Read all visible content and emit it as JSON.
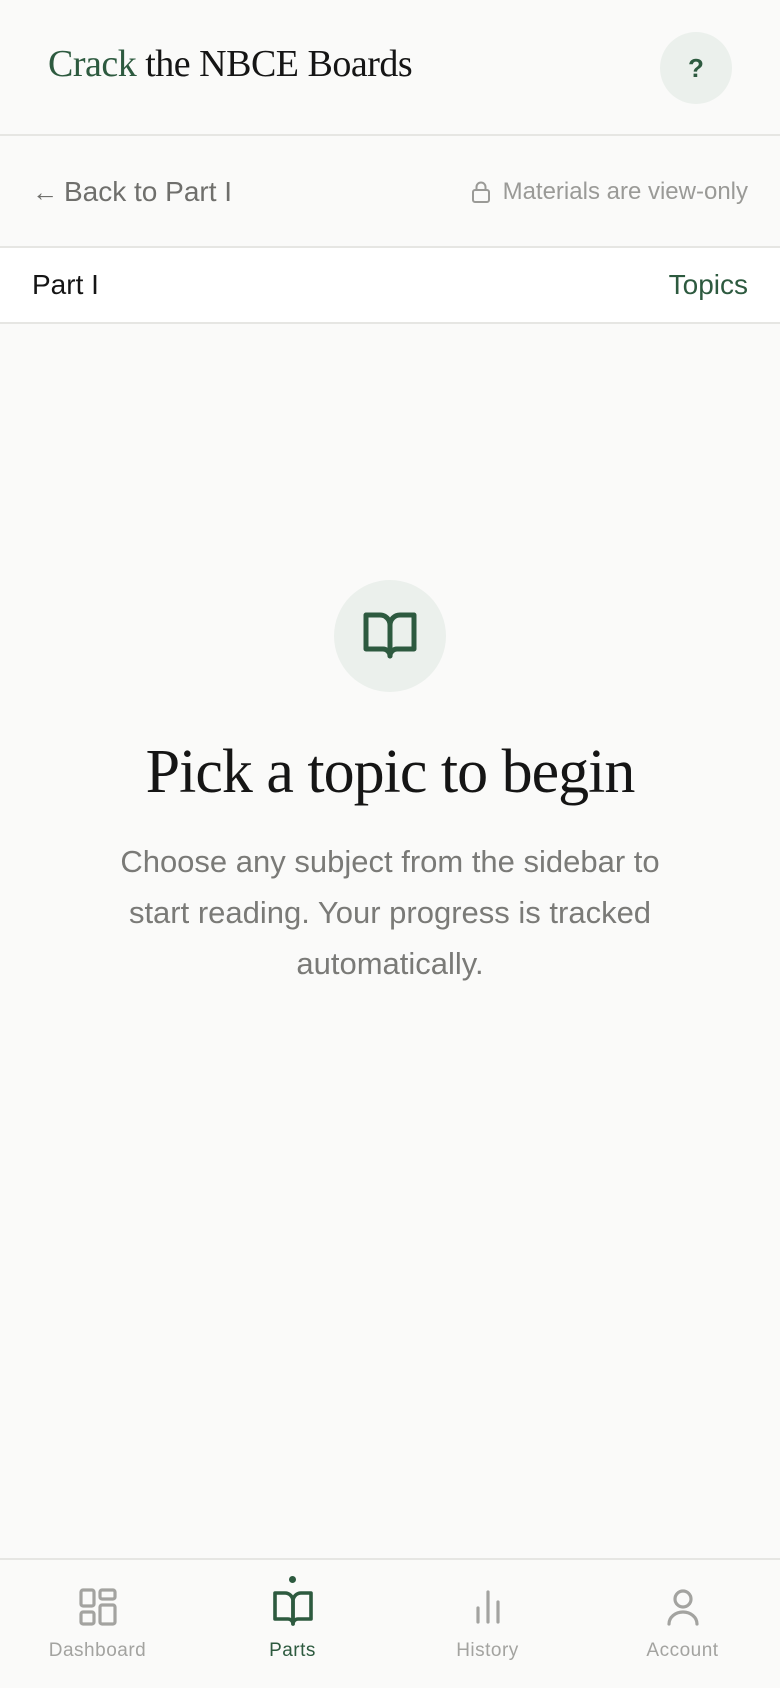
{
  "header": {
    "brand_accent": "Crack",
    "brand_rest": " the NBCE Boards",
    "help_label": "?"
  },
  "subbar": {
    "back_arrow": "←",
    "back_label": "Back to Part I",
    "view_only_label": "Materials are view-only"
  },
  "partbar": {
    "part_label": "Part I",
    "topics_label": "Topics"
  },
  "empty_state": {
    "title": "Pick a topic to begin",
    "description": "Choose any subject from the sidebar to start reading. Your progress is tracked automatically."
  },
  "bottom_nav": {
    "items": [
      {
        "label": "Dashboard",
        "icon": "dashboard-icon",
        "active": false
      },
      {
        "label": "Parts",
        "icon": "book-icon",
        "active": true
      },
      {
        "label": "History",
        "icon": "bar-chart-icon",
        "active": false
      },
      {
        "label": "Account",
        "icon": "user-icon",
        "active": false
      }
    ]
  },
  "colors": {
    "accent": "#2d5a3f",
    "accent_soft": "#ebf0ec",
    "background": "#fafaf9",
    "muted_text": "#7a7a77"
  }
}
